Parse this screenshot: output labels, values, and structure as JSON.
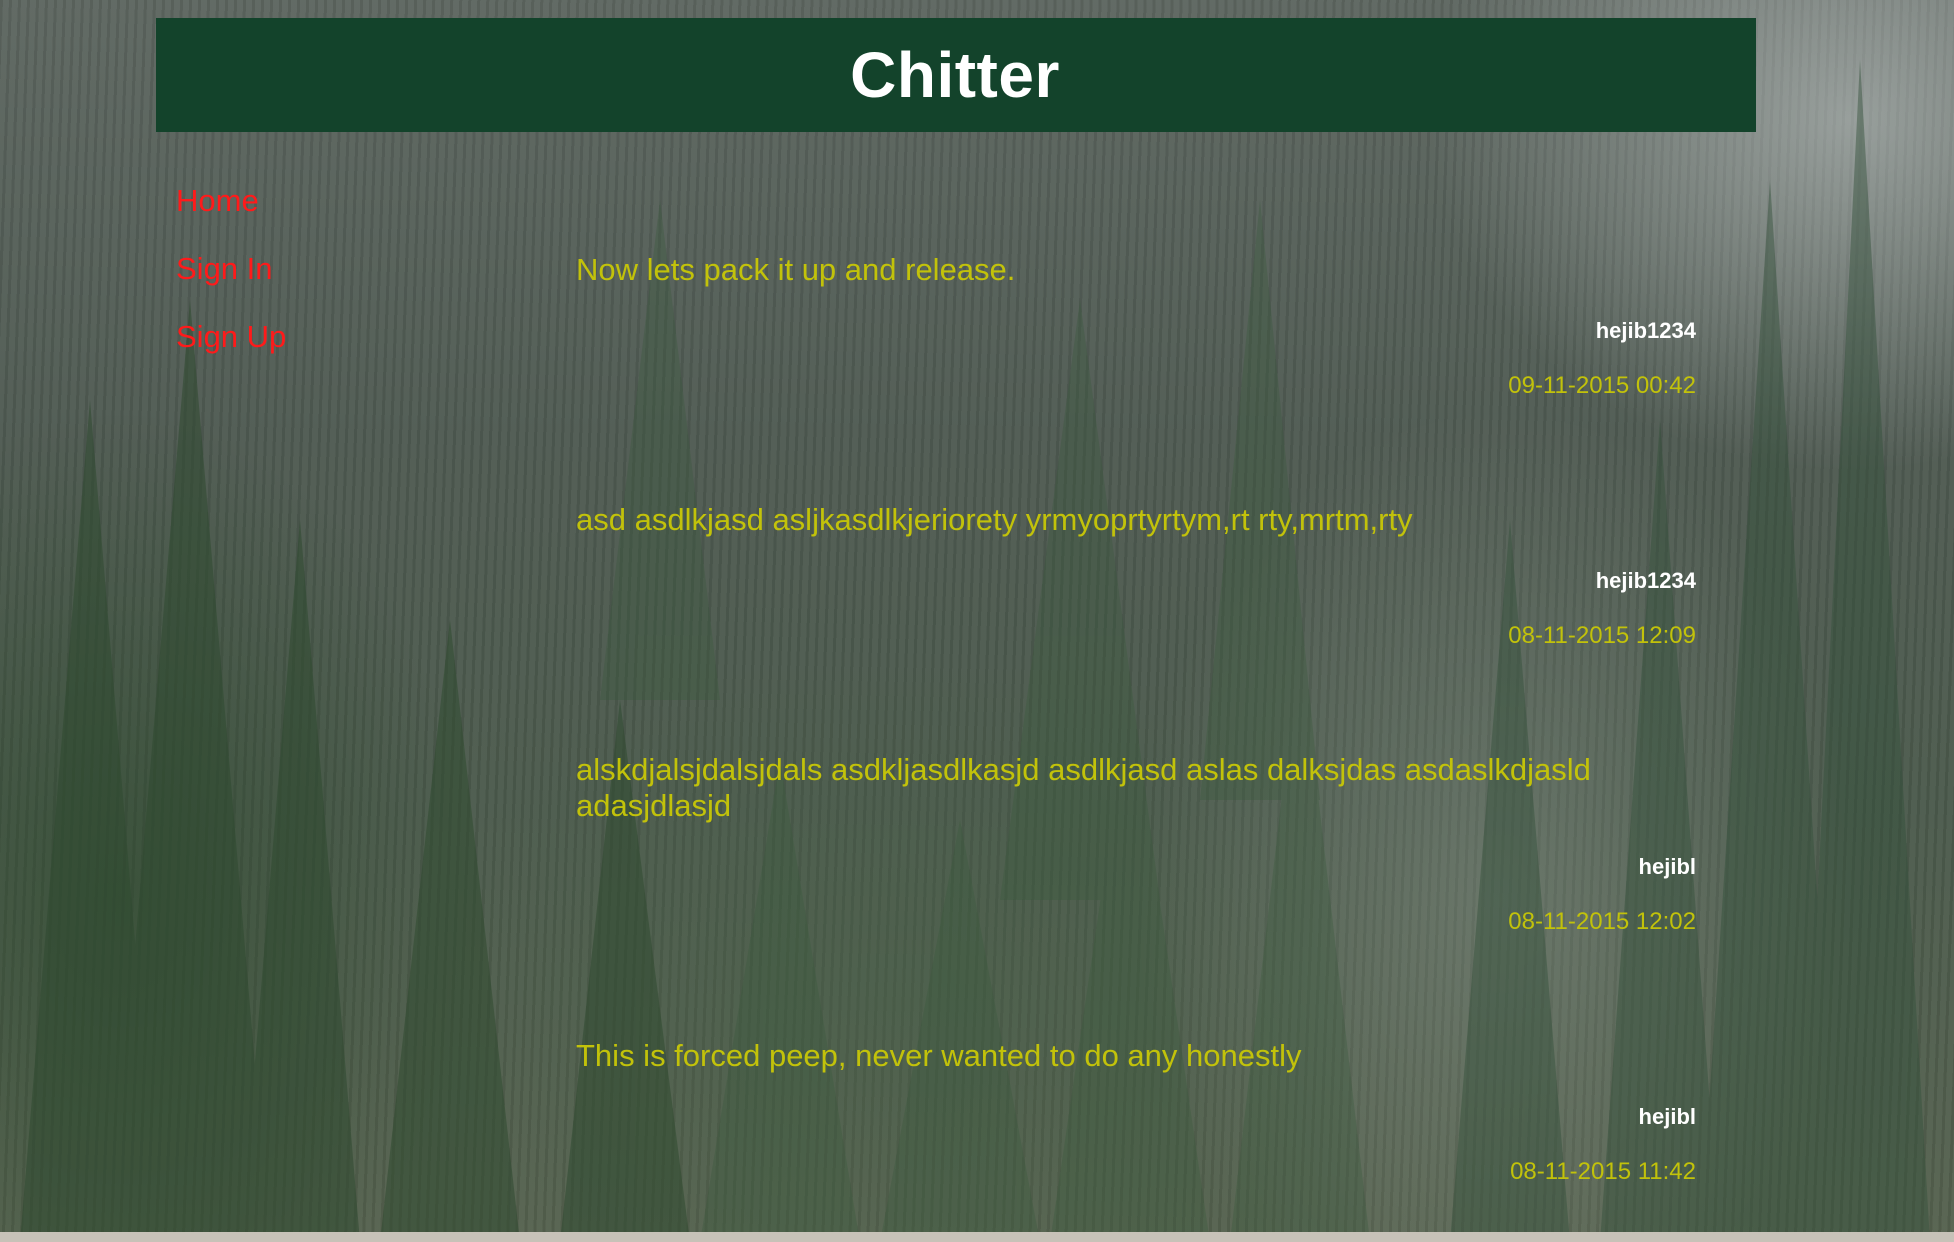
{
  "header": {
    "title": "Chitter"
  },
  "nav": {
    "items": [
      {
        "label": "Home"
      },
      {
        "label": "Sign In"
      },
      {
        "label": "Sign Up"
      }
    ]
  },
  "feed": {
    "peeps": [
      {
        "text": "Now lets pack it up and release.",
        "author": "hejib1234",
        "time": "09-11-2015 00:42"
      },
      {
        "text": "asd asdlkjasd asljkasdlkjeriorety yrmyoprtyrtym,rt rty,mrtm,rty",
        "author": "hejib1234",
        "time": "08-11-2015 12:09"
      },
      {
        "text": "alskdjalsjdalsjdals asdkljasdlkasjd asdlkjasd aslas dalksjdas asdaslkdjasld adasjdlasjd",
        "author": "hejibl",
        "time": "08-11-2015 12:02"
      },
      {
        "text": "This is forced peep, never wanted to do any honestly",
        "author": "hejibl",
        "time": "08-11-2015 11:42"
      }
    ]
  },
  "colors": {
    "header_bg": "#13432b",
    "nav_link": "#ff1a1a",
    "peep_text": "#c2c20a",
    "author": "#ffffff"
  }
}
